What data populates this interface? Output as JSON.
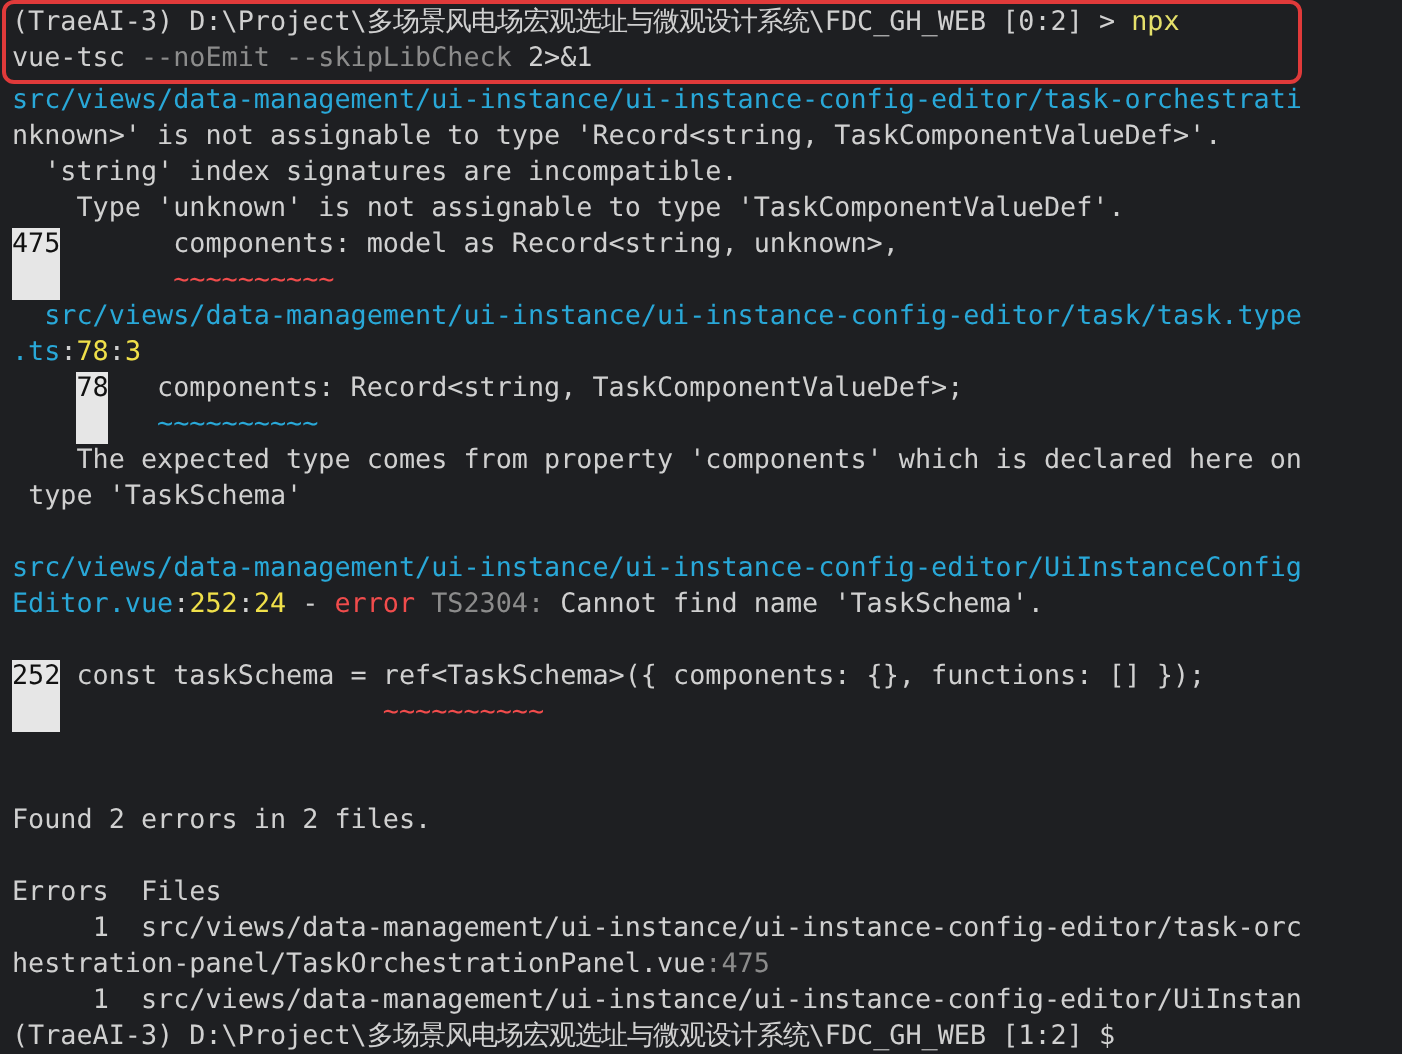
{
  "terminal": {
    "highlighted_block": {
      "lines": [
        {
          "kind": "text",
          "segments": [
            {
              "kind": "text",
              "text": "(TraeAI-3) D:\\Project\\多场景风电场宏观选址与微观设计系统\\FDC_GH_WEB [0:2] > "
            },
            {
              "kind": "command",
              "text": "npx"
            }
          ]
        },
        {
          "kind": "text",
          "segments": [
            {
              "kind": "text",
              "text": "vue-tsc"
            },
            {
              "kind": "dim",
              "text": " --noEmit --skipLibCheck"
            },
            {
              "kind": "text",
              "text": " 2>&1"
            }
          ]
        }
      ]
    },
    "lines": [
      {
        "kind": "text",
        "segments": [
          {
            "kind": "path",
            "text": "src/views/data-management/ui-instance/ui-instance-config-editor/task-orchestrati"
          }
        ]
      },
      {
        "kind": "text",
        "segments": [
          {
            "kind": "text",
            "text": "nknown>' is not assignable to type 'Record<string, TaskComponentValueDef>'."
          }
        ]
      },
      {
        "kind": "text",
        "segments": [
          {
            "kind": "text",
            "text": "  'string' index signatures are incompatible."
          }
        ]
      },
      {
        "kind": "text",
        "segments": [
          {
            "kind": "text",
            "text": "    Type 'unknown' is not assignable to type 'TaskComponentValueDef'."
          }
        ]
      },
      {
        "kind": "text",
        "segments": [
          {
            "kind": "gutter",
            "indented": false,
            "text": "475"
          },
          {
            "kind": "text",
            "text": "       components: model as Record<string, unknown>,"
          }
        ]
      },
      {
        "kind": "text",
        "segments": [
          {
            "kind": "gutter_blank",
            "indented": false
          },
          {
            "kind": "squiggle_error",
            "text": "       ~~~~~~~~~~"
          }
        ]
      },
      {
        "kind": "text",
        "segments": [
          {
            "kind": "path",
            "text": "  src/views/data-management/ui-instance/ui-instance-config-editor/task/task.type"
          }
        ]
      },
      {
        "kind": "text",
        "segments": [
          {
            "kind": "path",
            "text": ".ts"
          },
          {
            "kind": "text",
            "text": ":"
          },
          {
            "kind": "number",
            "text": "78"
          },
          {
            "kind": "text",
            "text": ":"
          },
          {
            "kind": "number",
            "text": "3"
          }
        ]
      },
      {
        "kind": "text",
        "segments": [
          {
            "kind": "gutter",
            "indented": true,
            "text": "78"
          },
          {
            "kind": "text",
            "text": "   components: Record<string, TaskComponentValueDef>;"
          }
        ]
      },
      {
        "kind": "text",
        "segments": [
          {
            "kind": "gutter_blank",
            "indented": true
          },
          {
            "kind": "squiggle_info",
            "text": "   ~~~~~~~~~~"
          }
        ]
      },
      {
        "kind": "text",
        "segments": [
          {
            "kind": "text",
            "text": "    The expected type comes from property 'components' which is declared here on"
          }
        ]
      },
      {
        "kind": "text",
        "segments": [
          {
            "kind": "text",
            "text": " type 'TaskSchema'"
          }
        ]
      },
      {
        "kind": "blank"
      },
      {
        "kind": "text",
        "segments": [
          {
            "kind": "path",
            "text": "src/views/data-management/ui-instance/ui-instance-config-editor/UiInstanceConfig"
          }
        ]
      },
      {
        "kind": "text",
        "segments": [
          {
            "kind": "path",
            "text": "Editor.vue"
          },
          {
            "kind": "text",
            "text": ":"
          },
          {
            "kind": "number",
            "text": "252"
          },
          {
            "kind": "text",
            "text": ":"
          },
          {
            "kind": "number",
            "text": "24"
          },
          {
            "kind": "text",
            "text": " - "
          },
          {
            "kind": "error",
            "text": "error"
          },
          {
            "kind": "dim",
            "text": " TS2304:"
          },
          {
            "kind": "text",
            "text": " Cannot find name 'TaskSchema'."
          }
        ]
      },
      {
        "kind": "blank"
      },
      {
        "kind": "text",
        "segments": [
          {
            "kind": "gutter",
            "indented": false,
            "text": "252"
          },
          {
            "kind": "text",
            "text": " const taskSchema = ref<TaskSchema>({ components: {}, functions: [] });"
          }
        ]
      },
      {
        "kind": "text",
        "segments": [
          {
            "kind": "gutter_blank",
            "indented": false
          },
          {
            "kind": "squiggle_error",
            "text": "                    ~~~~~~~~~~"
          }
        ]
      },
      {
        "kind": "blank"
      },
      {
        "kind": "blank"
      },
      {
        "kind": "text",
        "segments": [
          {
            "kind": "text",
            "text": "Found 2 errors in 2 files."
          }
        ]
      },
      {
        "kind": "blank"
      },
      {
        "kind": "text",
        "segments": [
          {
            "kind": "text",
            "text": "Errors  Files"
          }
        ]
      },
      {
        "kind": "text",
        "segments": [
          {
            "kind": "text",
            "text": "     1  src/views/data-management/ui-instance/ui-instance-config-editor/task-orc"
          }
        ]
      },
      {
        "kind": "text",
        "segments": [
          {
            "kind": "text",
            "text": "hestration-panel/TaskOrchestrationPanel.vue"
          },
          {
            "kind": "dim",
            "text": ":475"
          }
        ]
      },
      {
        "kind": "text",
        "segments": [
          {
            "kind": "text",
            "text": "     1  src/views/data-management/ui-instance/ui-instance-config-editor/UiInstan"
          }
        ]
      },
      {
        "kind": "text",
        "segments": [
          {
            "kind": "text",
            "text": "(TraeAI-3) D:\\Project\\多场景风电场宏观选址与微观设计系统\\FDC_GH_WEB [1:2] $"
          }
        ]
      }
    ]
  }
}
